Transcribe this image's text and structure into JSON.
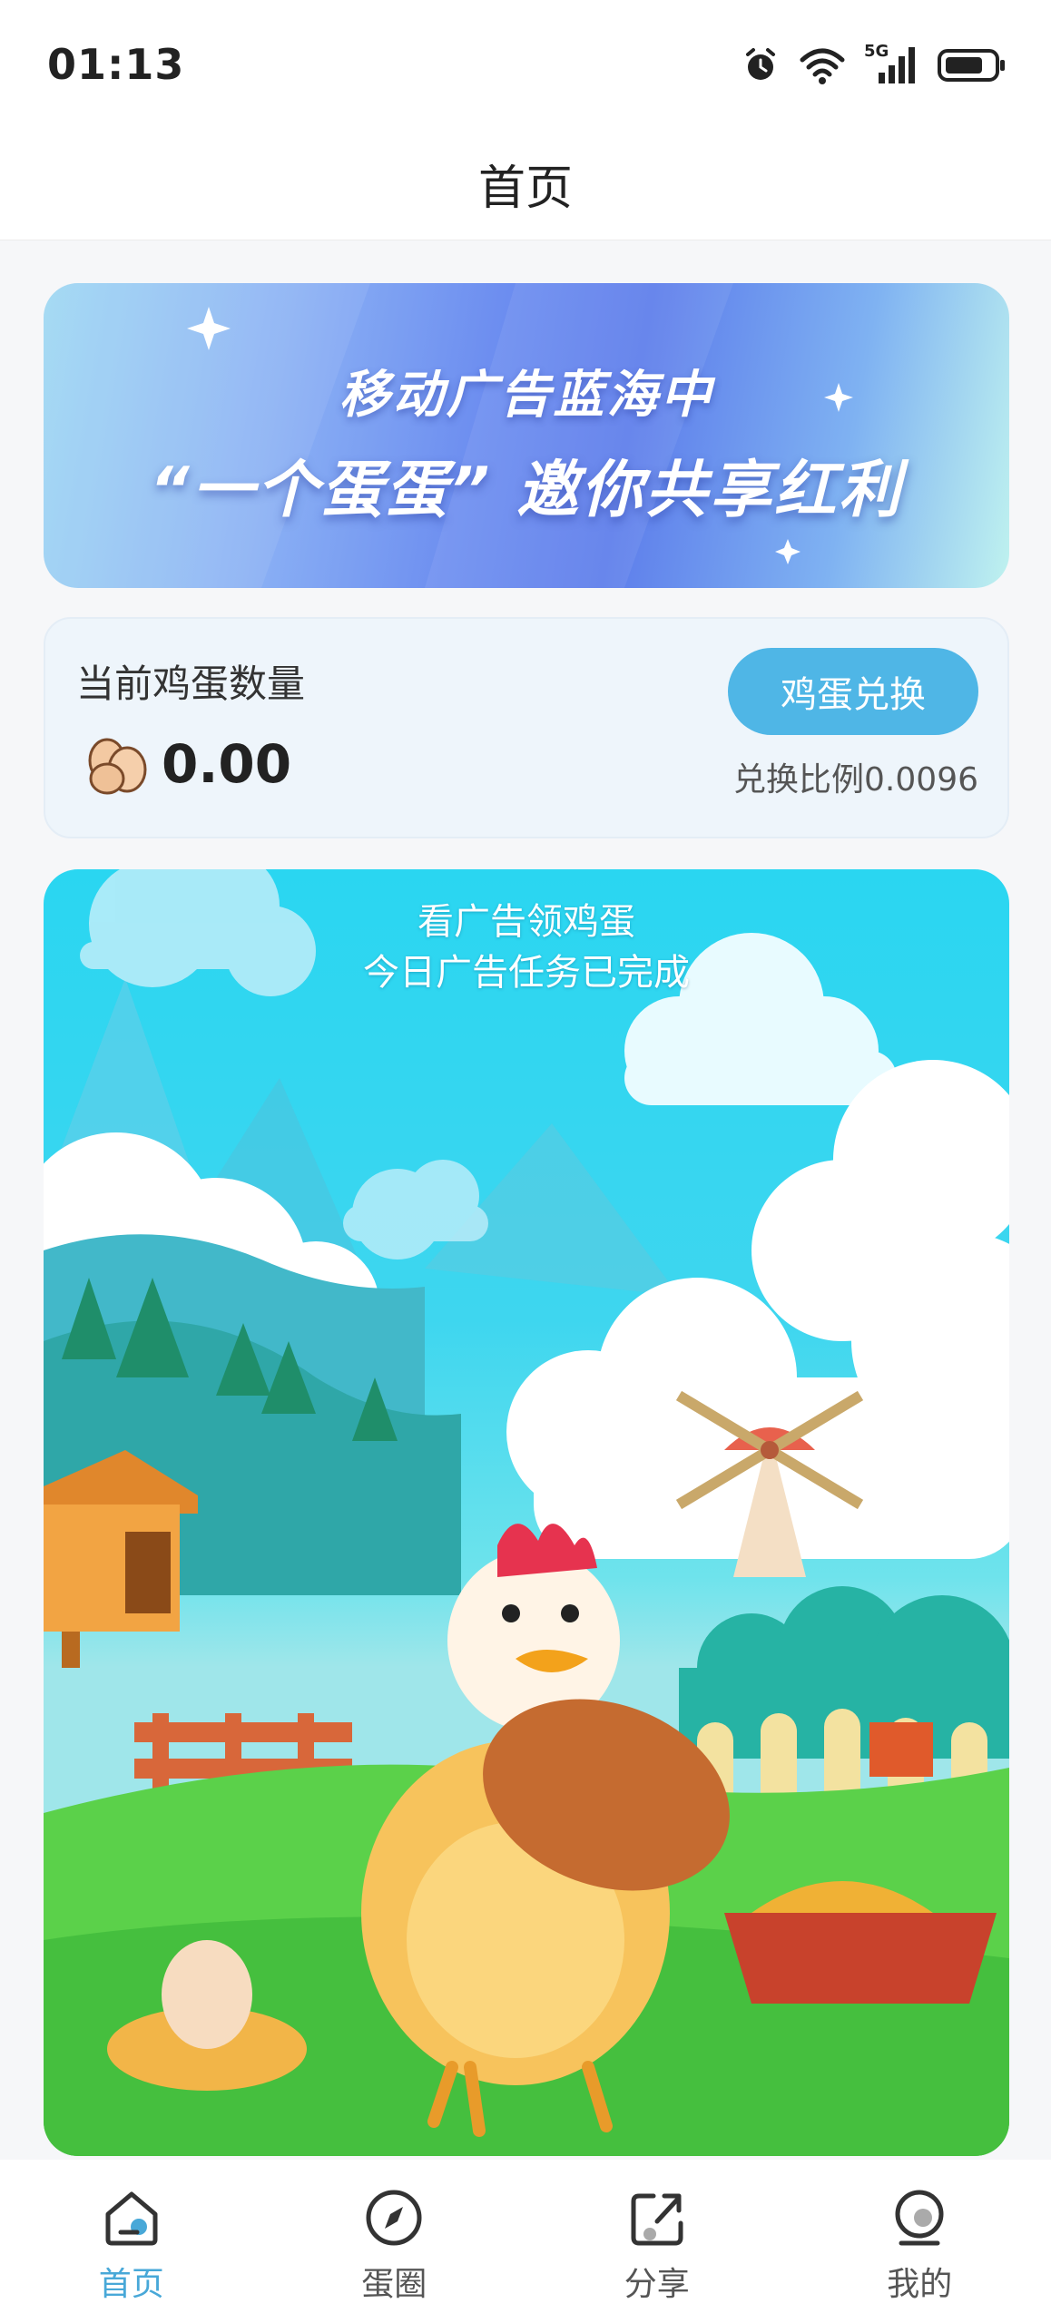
{
  "status_bar": {
    "time": "01:13",
    "network_label": "5G",
    "icons": [
      "alarm-icon",
      "wifi-icon",
      "signal-icon",
      "battery-icon"
    ]
  },
  "header": {
    "title": "首页"
  },
  "banner": {
    "line1": "移动广告蓝海中",
    "line2": "“一个蛋蛋” 邀你共享红利"
  },
  "egg_card": {
    "label": "当前鸡蛋数量",
    "count": "0.00",
    "exchange_button": "鸡蛋兑换",
    "ratio": "兑换比例0.0096"
  },
  "ad_card": {
    "title": "看广告领鸡蛋",
    "status": "今日广告任务已完成"
  },
  "bottom_nav": {
    "items": [
      {
        "label": "首页",
        "icon": "home-icon",
        "active": true
      },
      {
        "label": "蛋圈",
        "icon": "compass-icon",
        "active": false
      },
      {
        "label": "分享",
        "icon": "share-icon",
        "active": false
      },
      {
        "label": "我的",
        "icon": "profile-icon",
        "active": false
      }
    ]
  },
  "colors": {
    "accent": "#4fb6e6",
    "nav_active": "#48a8d8",
    "nav_inactive": "#555555"
  }
}
